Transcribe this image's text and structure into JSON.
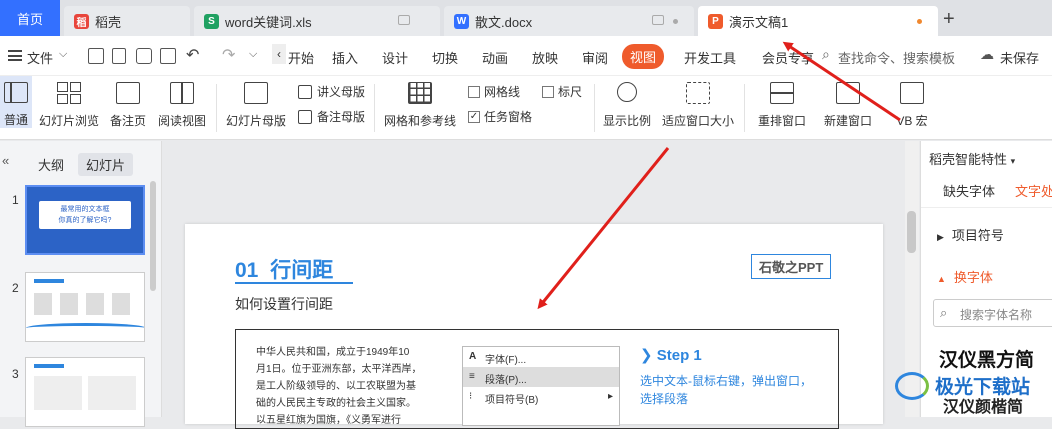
{
  "tabs": {
    "home": "首页",
    "docer": "稻壳",
    "word_xls": "word关键词.xls",
    "docx": "散文.docx",
    "ppt": "演示文稿1",
    "new_tab": "+"
  },
  "menu": {
    "file": "文件",
    "items": [
      "开始",
      "插入",
      "设计",
      "切换",
      "动画",
      "放映",
      "审阅",
      "视图",
      "开发工具",
      "会员专享"
    ],
    "search": "查找命令、搜索模板",
    "unsaved": "未保存"
  },
  "ribbon": {
    "normal": "普通",
    "slide_browse": "幻灯片浏览",
    "notes_page": "备注页",
    "reading_view": "阅读视图",
    "slide_master": "幻灯片母版",
    "handout_master": "讲义母版",
    "notes_master": "备注母版",
    "grid_guides": "网格和参考线",
    "gridlines": "网格线",
    "ruler": "标尺",
    "task_pane": "任务窗格",
    "zoom": "显示比例",
    "fit_window": "适应窗口大小",
    "arrange": "重排窗口",
    "new_window": "新建窗口",
    "macro": "VB 宏"
  },
  "left_panel": {
    "outline_tab": "大纲",
    "slides_tab": "幻灯片",
    "slide_numbers": [
      "1",
      "2",
      "3"
    ],
    "thumb1_line1": "最常用的文本框",
    "thumb1_line2": "你真的了解它吗?"
  },
  "slide": {
    "heading_num": "01",
    "heading_text": "行间距",
    "subtitle": "如何设置行间距",
    "badge": "石敬之PPT",
    "body_lines": [
      "中华人民共和国，成立于1949年10",
      "月1日。位于亚洲东部，太平洋西岸，",
      "是工人阶级领导的、以工农联盟为基",
      "础的人民民主专政的社会主义国家。",
      "以五星红旗为国旗，《义勇军进行"
    ],
    "context_menu": [
      "字体(F)...",
      "段落(P)...",
      "项目符号(B)"
    ],
    "step_title": "Step 1",
    "step_desc_1": "选中文本-鼠标右键，弹出窗口，",
    "step_desc_2": "选择段落"
  },
  "right_panel": {
    "title": "稻壳智能特性",
    "tab_missing_font": "缺失字体",
    "tab_text": "文字处",
    "bullets": "项目符号",
    "change_font": "换字体",
    "font_search": "搜索字体名称",
    "font_sample_1": "汉仪黑方简",
    "font_sample_2": "汉仪颜楷简"
  },
  "watermark": {
    "name": "极光下载站"
  },
  "colors": {
    "brand_blue": "#3370ff",
    "accent_orange": "#ef5b2c",
    "slide_blue": "#2e86de",
    "arrow_red": "#e0201b"
  }
}
